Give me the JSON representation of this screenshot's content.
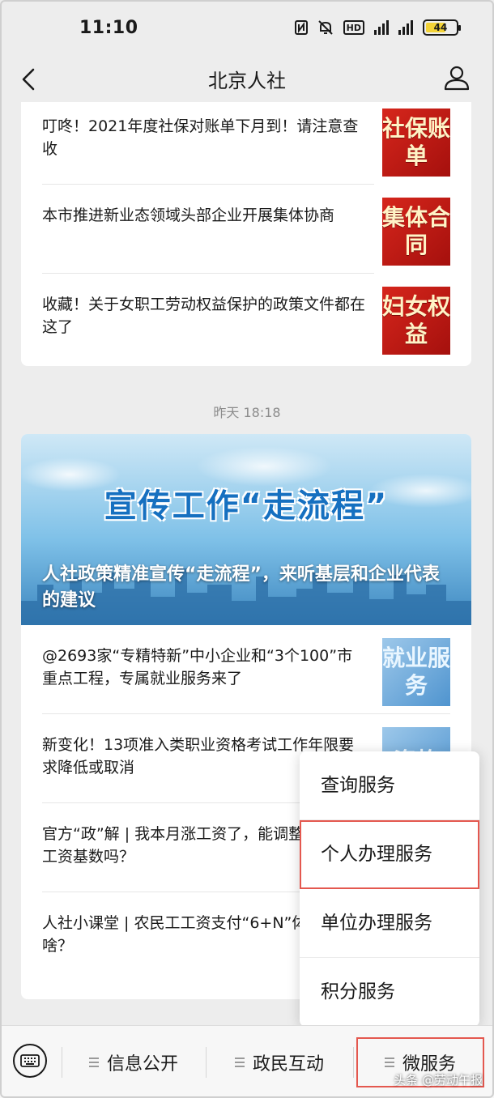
{
  "status_bar": {
    "time": "11:10",
    "battery": "44",
    "hd_label": "HD",
    "icons": [
      "nfc-icon",
      "mute-icon",
      "hd-icon",
      "signal-icon",
      "signal-icon",
      "battery-icon"
    ]
  },
  "nav": {
    "title": "北京人社",
    "back_icon": "chevron-left-icon",
    "profile_icon": "person-icon"
  },
  "top_news": [
    {
      "title": "叮咚！2021年度社保对账单下月到！请注意查收",
      "thumb_text": "社保账单",
      "thumb_color": "red"
    },
    {
      "title": "本市推进新业态领域头部企业开展集体协商",
      "thumb_text": "集体合同",
      "thumb_color": "red"
    },
    {
      "title": "收藏！关于女职工劳动权益保护的政策文件都在这了",
      "thumb_text": "妇女权益",
      "thumb_color": "red"
    }
  ],
  "timestamp": "昨天 18:18",
  "feature": {
    "banner_headline": "宣传工作“走流程”",
    "caption": "人社政策精准宣传“走流程”，来听基层和企业代表的建议"
  },
  "bottom_news": [
    {
      "title": "@2693家“专精特新”中小企业和“3个100”市重点工程，专属就业服务来了",
      "thumb_text": "就业服务",
      "thumb_color": "blue"
    },
    {
      "title": "新变化！13项准入类职业资格考试工作年限要求降低或取消",
      "thumb_text": "资格",
      "thumb_color": "blue"
    },
    {
      "title": "官方“政”解 | 我本月涨工资了，能调整社保缴费工资基数吗？",
      "thumb_text": "",
      "thumb_color": "blue"
    },
    {
      "title": "人社小课堂 | 农民工工资支付“6+N”体系是个啥？",
      "thumb_text": "",
      "thumb_color": "blue"
    }
  ],
  "popup_menu": {
    "items": [
      "查询服务",
      "个人办理服务",
      "单位办理服务",
      "积分服务"
    ],
    "highlighted": "个人办理服务"
  },
  "bottom_bar": {
    "keyboard_icon": "keyboard-icon",
    "tabs": [
      "信息公开",
      "政民互动",
      "微服务"
    ],
    "highlighted": "微服务"
  },
  "watermark": "头条 @劳动午报",
  "colors": {
    "accent_red": "#e4584f",
    "thumb_red": "#d6261c",
    "banner_blue": "#1670c0"
  }
}
